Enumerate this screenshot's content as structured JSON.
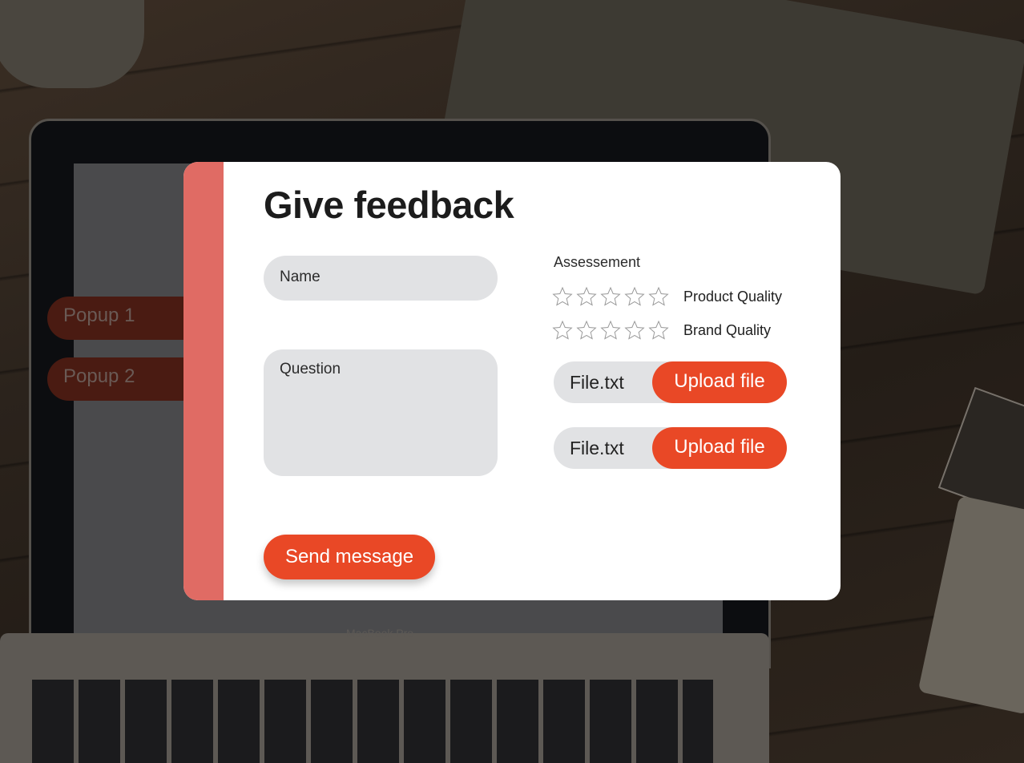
{
  "background": {
    "laptop_label": "MacBook Pro"
  },
  "popups": [
    {
      "label": "Popup 1"
    },
    {
      "label": "Popup 2"
    }
  ],
  "modal": {
    "title": "Give feedback",
    "name_placeholder": "Name",
    "question_placeholder": "Question",
    "send_label": "Send message",
    "assessment": {
      "label": "Assessement",
      "ratings": [
        {
          "label": "Product Quality",
          "stars": 0,
          "max": 5
        },
        {
          "label": "Brand Quality",
          "stars": 0,
          "max": 5
        }
      ]
    },
    "uploads": [
      {
        "file_name": "File.txt",
        "button_label": "Upload file"
      },
      {
        "file_name": "File.txt",
        "button_label": "Upload file"
      }
    ]
  },
  "colors": {
    "accent": "#e94826",
    "stripe": "#e06b64",
    "field_bg": "#e1e2e4"
  }
}
